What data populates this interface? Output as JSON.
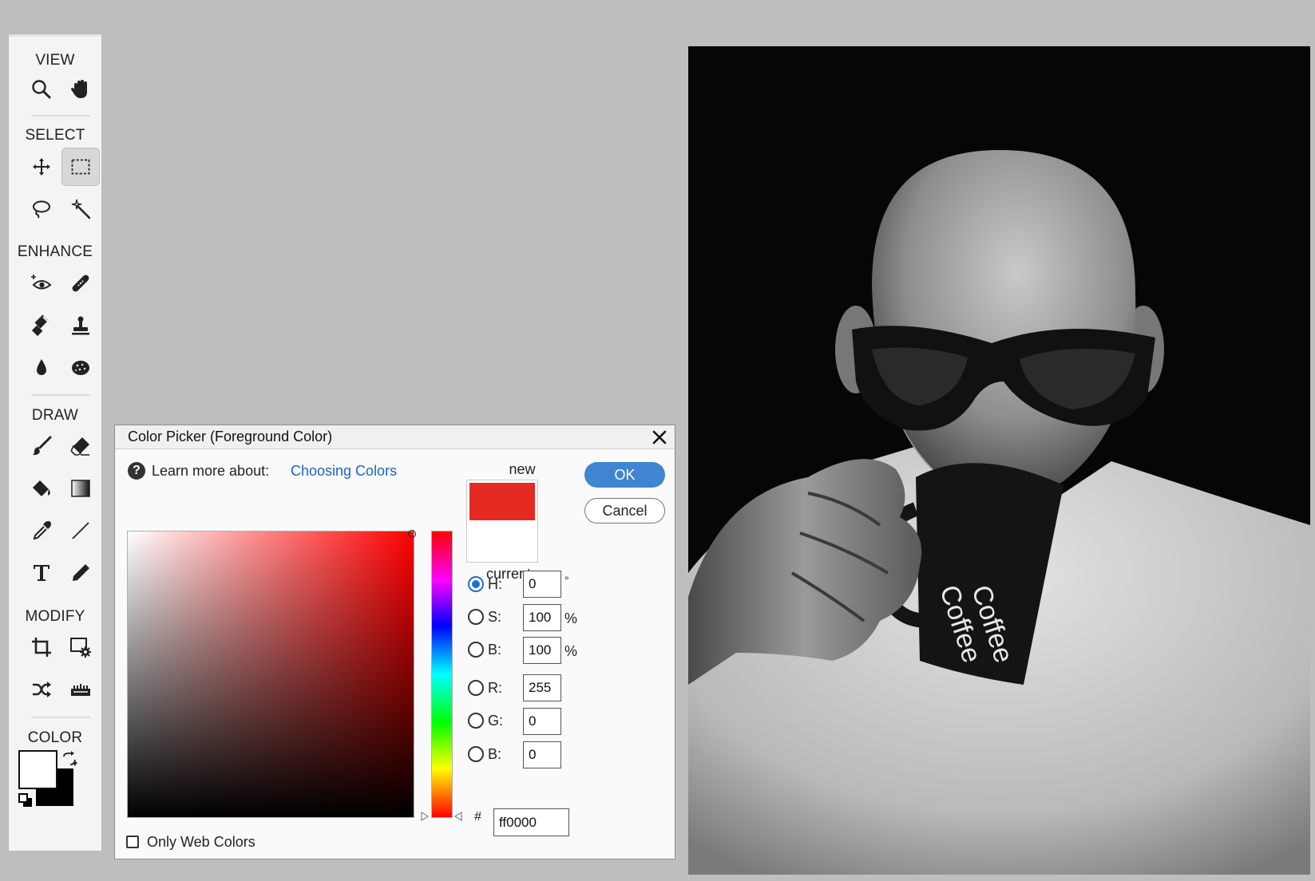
{
  "toolbox": {
    "sections": {
      "view": "VIEW",
      "select": "SELECT",
      "enhance": "ENHANCE",
      "draw": "DRAW",
      "modify": "MODIFY",
      "color": "COLOR"
    },
    "active_tool": "rectangular-marquee-tool"
  },
  "dialog": {
    "title": "Color Picker (Foreground Color)",
    "learn_more_label": "Learn more about:",
    "learn_more_link": "Choosing Colors",
    "new_label": "new",
    "current_label": "current",
    "ok_label": "OK",
    "cancel_label": "Cancel",
    "only_web_colors_label": "Only Web Colors",
    "only_web_colors_checked": false,
    "fields": {
      "h": {
        "label": "H:",
        "value": "0",
        "unit": "°",
        "selected": true
      },
      "s": {
        "label": "S:",
        "value": "100",
        "unit": "%",
        "selected": false
      },
      "b": {
        "label": "B:",
        "value": "100",
        "unit": "%",
        "selected": false
      },
      "r": {
        "label": "R:",
        "value": "255",
        "selected": false
      },
      "g": {
        "label": "G:",
        "value": "0",
        "selected": false
      },
      "b2": {
        "label": "B:",
        "value": "0",
        "selected": false
      }
    },
    "hex_label": "#",
    "hex_value": "ff0000",
    "new_color": "#e52a22",
    "current_color": "#ffffff"
  },
  "colors": {
    "foreground": "#ffffff",
    "background": "#000000",
    "accent": "#3f85d1"
  },
  "photo": {
    "mug_text": "Coffee"
  }
}
